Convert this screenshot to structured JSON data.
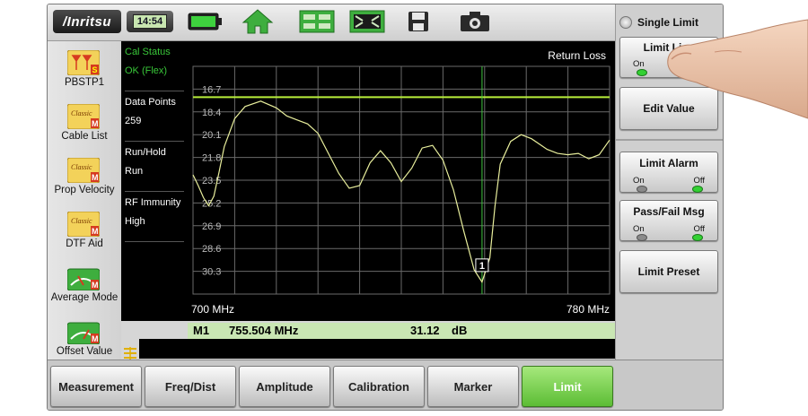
{
  "toolbar": {
    "brand": "/Inritsu",
    "clock": "14:54",
    "icons": [
      "battery-icon",
      "home-icon",
      "layout-icon",
      "fullscreen-icon",
      "save-icon",
      "camera-icon"
    ]
  },
  "sidebar": {
    "items": [
      {
        "label": "PBSTP1",
        "badge": "S"
      },
      {
        "label": "Cable List",
        "badge": "M"
      },
      {
        "label": "Prop Velocity",
        "badge": "M"
      },
      {
        "label": "DTF Aid",
        "badge": "M"
      },
      {
        "label": "Average Mode",
        "badge": "M"
      },
      {
        "label": "Offset Value",
        "badge": "M"
      }
    ],
    "classic_tag": "Classic"
  },
  "info": {
    "cal_status_label": "Cal Status",
    "cal_status_value": "OK (Flex)",
    "data_points_label": "Data Points",
    "data_points_value": "259",
    "run_hold_label": "Run/Hold",
    "run_hold_value": "Run",
    "rf_immunity_label": "RF Immunity",
    "rf_immunity_value": "High"
  },
  "chart_data": {
    "type": "line",
    "title": "Return Loss",
    "x_start_label": "700 MHz",
    "x_stop_label": "780 MHz",
    "xlim": [
      700,
      780
    ],
    "y_tick_labels": [
      "16.7",
      "18.4",
      "20.1",
      "21.8",
      "23.5",
      "25.2",
      "26.9",
      "28.6",
      "30.3"
    ],
    "ylim": [
      15.0,
      32.0
    ],
    "y_inverted": true,
    "limit_line": 17.3,
    "marker": {
      "label": "1",
      "x": 755.504,
      "y": 31.12
    },
    "series": [
      {
        "x": [
          700,
          701,
          702,
          703,
          704,
          705,
          706,
          708,
          710,
          713,
          716,
          718,
          720,
          722,
          724,
          726,
          728,
          730,
          732,
          734,
          736,
          738,
          740,
          742,
          744,
          746,
          748,
          750,
          752,
          754,
          755.5,
          757,
          758,
          759,
          761,
          763,
          765,
          768,
          770,
          772,
          774,
          776,
          778,
          780
        ],
        "y": [
          23.1,
          23.9,
          24.8,
          25.4,
          24.7,
          22.9,
          21.0,
          18.9,
          18.0,
          17.6,
          18.1,
          18.7,
          19.0,
          19.3,
          20.0,
          21.5,
          23.0,
          24.1,
          23.9,
          22.2,
          21.3,
          22.2,
          23.6,
          22.6,
          21.1,
          20.9,
          22.0,
          24.2,
          27.3,
          30.2,
          31.1,
          29.3,
          25.4,
          22.3,
          20.6,
          20.1,
          20.4,
          21.2,
          21.5,
          21.6,
          21.5,
          21.9,
          21.6,
          20.5
        ]
      }
    ],
    "grid": true,
    "colors": {
      "trace": "#e8ee9c",
      "limit": "#b8ee3a",
      "marker": "#3ec43e",
      "grid": "#6a6a6a"
    }
  },
  "readout": {
    "marker": "M1",
    "frequency": "755.504 MHz",
    "value": "31.12",
    "unit": "dB"
  },
  "right_panel": {
    "single_limit": "Single Limit",
    "limit_line": {
      "label": "Limit Line",
      "on": "On",
      "state": "on"
    },
    "edit_value": "Edit Value",
    "limit_alarm": {
      "label": "Limit Alarm",
      "on": "On",
      "off": "Off",
      "state": "off"
    },
    "pass_fail": {
      "label": "Pass/Fail Msg",
      "on": "On",
      "off": "Off",
      "state": "off"
    },
    "limit_preset": "Limit Preset"
  },
  "tabs": [
    {
      "label": "Measurement",
      "active": false
    },
    {
      "label": "Freq/Dist",
      "active": false
    },
    {
      "label": "Amplitude",
      "active": false
    },
    {
      "label": "Calibration",
      "active": false
    },
    {
      "label": "Marker",
      "active": false
    },
    {
      "label": "Limit",
      "active": true
    }
  ],
  "colors": {
    "active_tab": "#5cbd35",
    "info_text_green": "#39c739",
    "readout_bg": "#c9e6b3"
  }
}
